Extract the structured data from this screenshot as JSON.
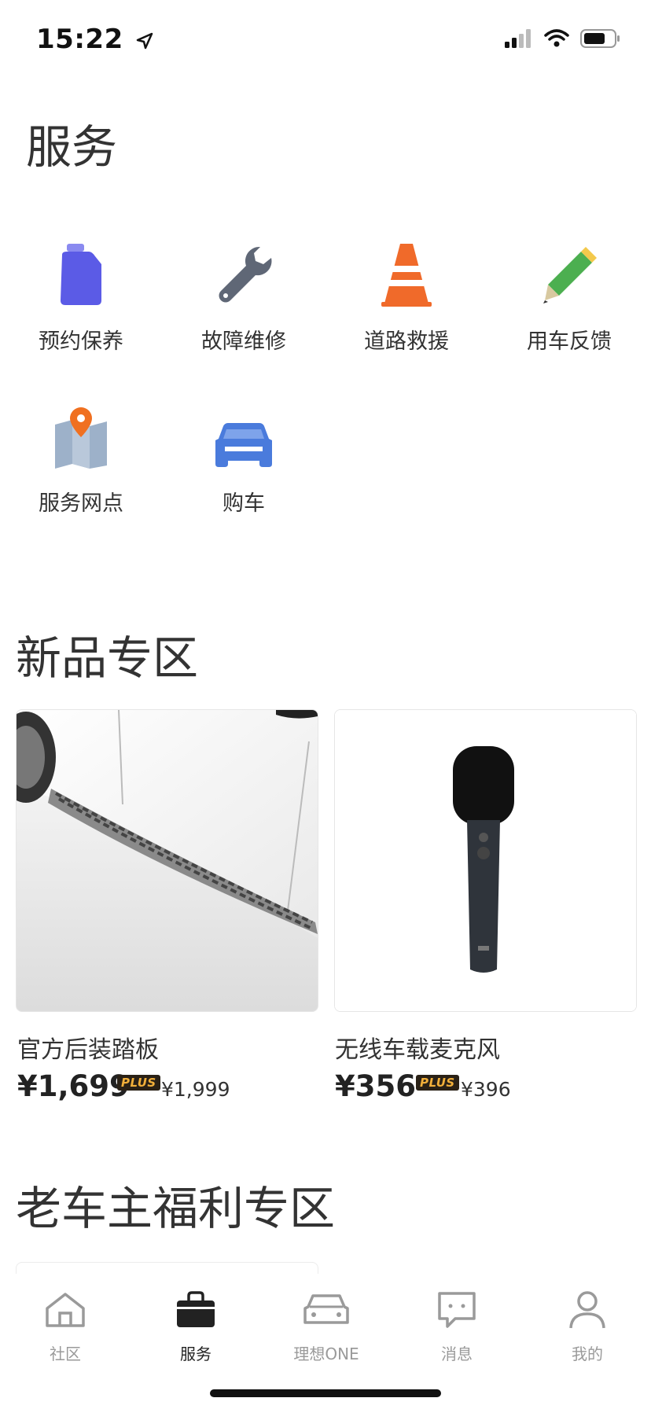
{
  "status_bar": {
    "time": "15:22"
  },
  "services": {
    "title": "服务",
    "items": [
      {
        "label": "预约保养",
        "icon": "oil-can-icon"
      },
      {
        "label": "故障维修",
        "icon": "wrench-icon"
      },
      {
        "label": "道路救援",
        "icon": "traffic-cone-icon"
      },
      {
        "label": "用车反馈",
        "icon": "pencil-icon"
      },
      {
        "label": "服务网点",
        "icon": "map-pin-icon"
      },
      {
        "label": "购车",
        "icon": "car-icon"
      }
    ]
  },
  "new_products": {
    "title": "新品专区",
    "items": [
      {
        "name": "官方后装踏板",
        "price": "¥1,699",
        "badge": "PLUS",
        "original_price": "¥1,999",
        "image": "running-board-photo"
      },
      {
        "name": "无线车载麦克风",
        "price": "¥356",
        "badge": "PLUS",
        "original_price": "¥396",
        "image": "microphone-photo"
      }
    ]
  },
  "owner_benefits": {
    "title": "老车主福利专区"
  },
  "tabbar": {
    "items": [
      {
        "label": "社区",
        "icon": "home-icon",
        "active": false
      },
      {
        "label": "服务",
        "icon": "bag-icon",
        "active": true
      },
      {
        "label": "理想ONE",
        "icon": "car-outline-icon",
        "active": false
      },
      {
        "label": "消息",
        "icon": "chat-icon",
        "active": false
      },
      {
        "label": "我的",
        "icon": "person-icon",
        "active": false
      }
    ]
  },
  "colors": {
    "oil_can": "#5b5be6",
    "wrench": "#5f6776",
    "cone": "#f06a2a",
    "pencil": "#4caf50",
    "pin": "#f07020",
    "car": "#4a7bdc",
    "badge_bg": "#2a2116",
    "badge_text": "#f3b03a"
  }
}
